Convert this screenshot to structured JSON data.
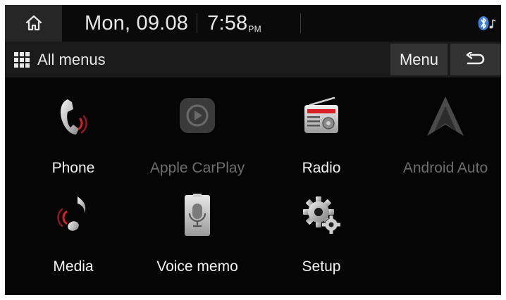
{
  "status_bar": {
    "home_icon": "home-icon",
    "date": "Mon, 09.08",
    "time": "7:58",
    "ampm": "PM",
    "bluetooth_icon": "bluetooth-music-icon"
  },
  "menu_bar": {
    "grid_icon": "grid-icon",
    "title": "All menus",
    "menu_label": "Menu",
    "back_icon": "back-arrow-icon"
  },
  "apps": [
    {
      "label": "Phone",
      "icon": "phone-icon",
      "enabled": true
    },
    {
      "label": "Apple CarPlay",
      "icon": "carplay-icon",
      "enabled": false
    },
    {
      "label": "Radio",
      "icon": "radio-icon",
      "enabled": true
    },
    {
      "label": "Android Auto",
      "icon": "android-auto-icon",
      "enabled": false
    },
    {
      "label": "Media",
      "icon": "music-note-icon",
      "enabled": true
    },
    {
      "label": "Voice memo",
      "icon": "microphone-icon",
      "enabled": true
    },
    {
      "label": "Setup",
      "icon": "gear-icon",
      "enabled": true
    }
  ],
  "colors": {
    "background": "#050505",
    "bar": "#1b1b1b",
    "button": "#333333",
    "text": "#f2f2f2",
    "disabled_text": "#6e6e6e",
    "accent_red": "#d81f26"
  }
}
